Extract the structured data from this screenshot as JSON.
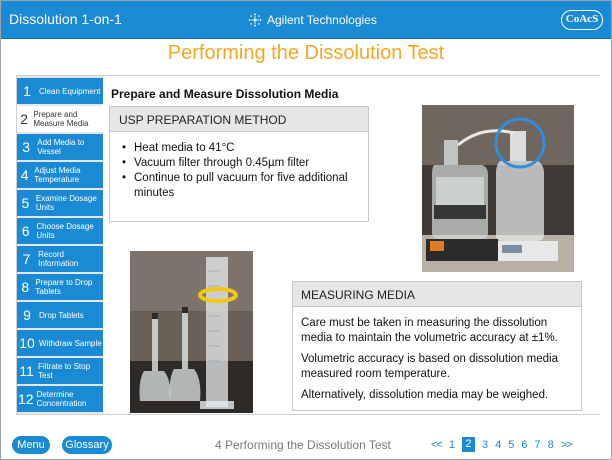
{
  "header": {
    "app_title": "Dissolution 1-on-1",
    "brand": "Agilent Technologies",
    "badge": "CoAcS"
  },
  "page_title": "Performing the Dissolution Test",
  "steps": [
    {
      "num": "1",
      "label": "Clean Equipment"
    },
    {
      "num": "2",
      "label": "Prepare and Measure Media"
    },
    {
      "num": "3",
      "label": "Add Media to Vessel"
    },
    {
      "num": "4",
      "label": "Adjust Media Temperature"
    },
    {
      "num": "5",
      "label": "Examine Dosage Units"
    },
    {
      "num": "6",
      "label": "Choose Dosage Units"
    },
    {
      "num": "7",
      "label": "Record Information"
    },
    {
      "num": "8",
      "label": "Prepare to Drop Tablets"
    },
    {
      "num": "9",
      "label": "Drop Tablets"
    },
    {
      "num": "10",
      "label": "Withdraw Sample"
    },
    {
      "num": "11",
      "label": "Filtrate to Stop Test"
    },
    {
      "num": "12",
      "label": "Determine Concentration"
    }
  ],
  "active_step": 2,
  "content": {
    "heading": "Prepare and Measure Dissolution Media",
    "usp": {
      "title": "USP PREPARATION METHOD",
      "bullets": [
        "Heat media to 41°C",
        "Vacuum filter through 0.45µm filter",
        "Continue to pull vacuum for five additional minutes"
      ]
    },
    "measuring": {
      "title": "MEASURING MEDIA",
      "paragraphs": [
        "Care must be taken in measuring the dissolution media to maintain the volumetric accuracy at ±1%.",
        "Volumetric accuracy is based on dissolution media measured room temperature.",
        "Alternatively, dissolution media may be weighed."
      ]
    }
  },
  "footer": {
    "menu_label": "Menu",
    "glossary_label": "Glossary",
    "page_label": "4 Performing the Dissolution Test",
    "prev": "<<",
    "next": ">>",
    "pages": [
      "1",
      "2",
      "3",
      "4",
      "5",
      "6",
      "7",
      "8"
    ],
    "current_page": "2"
  },
  "colors": {
    "accent_blue": "#1a8ad4",
    "title_orange": "#f5a623"
  }
}
